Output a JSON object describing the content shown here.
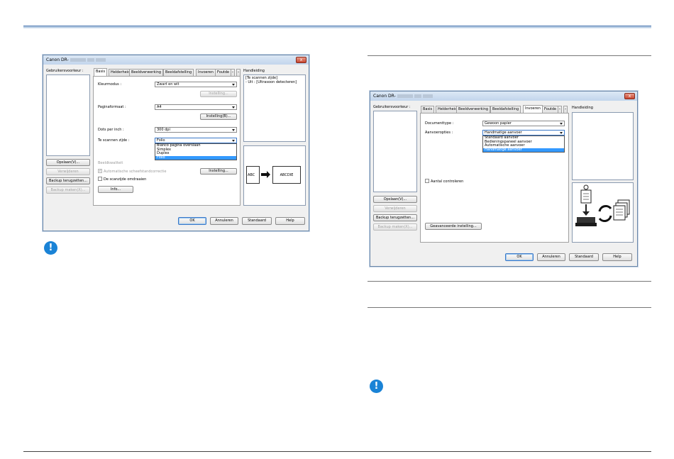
{
  "window1": {
    "title": "Canon DR-",
    "close": "x",
    "user_prefs_label": "Gebruikersvoorkeur :",
    "buttons": {
      "save": "Opslaan(V)...",
      "delete": "Verwijderen",
      "restore": "Backup terugzetten...",
      "backup": "Backup maken(X)...",
      "ok": "OK",
      "cancel": "Annuleren",
      "default": "Standaard",
      "help": "Help"
    },
    "tabs": [
      "Basis",
      "Helderheid",
      "Beeldverwerking",
      "Beeldafstelling",
      "Invoeren",
      "Foutde"
    ],
    "tab_scroll": [
      "‹",
      "›"
    ],
    "color_mode_label": "Kleurmodus :",
    "color_mode_value": "Zwart en wit",
    "setting_btn_1": "Instelling...",
    "page_size_label": "Paginaformaat :",
    "page_size_value": "A4",
    "setting_btn_2": "Instelling(B)...",
    "dpi_label": "Dots per inch :",
    "dpi_value": "300 dpi",
    "scan_side_label": "Te scannen zijde :",
    "scan_side_value": "Folio",
    "scan_side_options": [
      "Blanco pagina overslaan",
      "Simplex",
      "Duplex",
      "Folio"
    ],
    "scan_side_selected": 3,
    "image_quality_label": "Beeldkwaliteit",
    "auto_skew_label": "Automatische scheefstandcorrectie",
    "setting_btn_3": "Instelling...",
    "scan_area_label": "De scanzijde omdraaien",
    "info_btn": "Info...",
    "guide_label": "Handleiding",
    "guide_text": [
      "[Te scannen zijde]",
      "- Uit : [Ultrasoon detecteren]"
    ],
    "preview_left": "ABC",
    "preview_right": "ABCDIE"
  },
  "window2": {
    "title": "Canon DR-",
    "close": "x",
    "user_prefs_label": "Gebruikersvoorkeur :",
    "buttons": {
      "save": "Opslaan(V)...",
      "delete": "Verwijderen",
      "restore": "Backup terugzetten...",
      "backup": "Backup maken(X)...",
      "ok": "OK",
      "cancel": "Annuleren",
      "default": "Standaard",
      "help": "Help"
    },
    "tabs": [
      "Basis",
      "Helderheid",
      "Beeldverwerking",
      "Beeldafstelling",
      "Invoeren",
      "Foutde"
    ],
    "tab_scroll": [
      "‹",
      "›"
    ],
    "doc_type_label": "Documenttype :",
    "doc_type_value": "Gewoon papier",
    "feed_label": "Aanvoeropties :",
    "feed_value": "Handmatige aanvoer",
    "feed_options": [
      "Standaard aanvoer",
      "Bedieningspaneel aanvoer",
      "Automatische aanvoer",
      "Handmatige aanvoer"
    ],
    "feed_selected": 3,
    "count_label": "Aantal controleren",
    "advanced_btn": "Geavanceerde instelling...",
    "guide_label": "Handleiding"
  },
  "notes": [
    "!",
    "!"
  ]
}
